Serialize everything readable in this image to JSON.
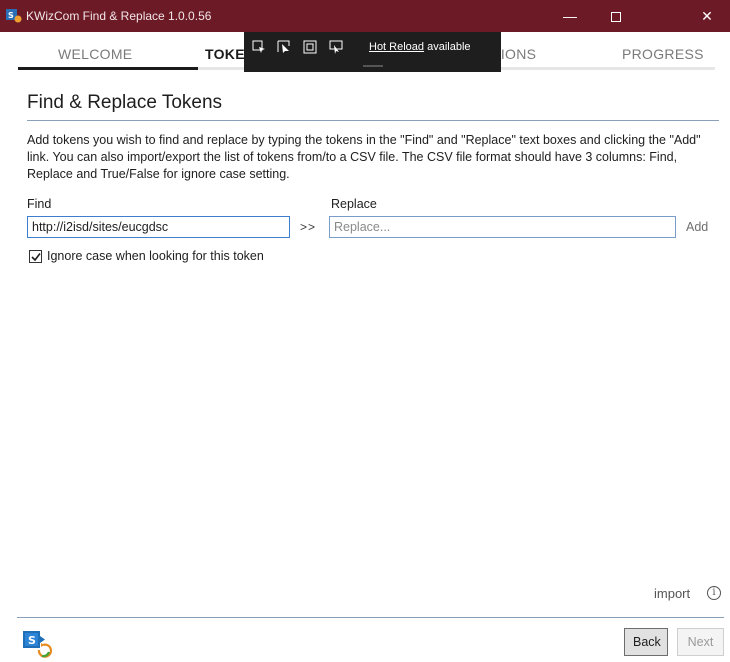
{
  "window": {
    "title": "KWizCom Find & Replace 1.0.0.56",
    "minimize_glyph": "—",
    "close_glyph": "✕"
  },
  "tabs": [
    {
      "label": "WELCOME"
    },
    {
      "label": "TOKEN"
    },
    {
      "label": "TIONS"
    },
    {
      "label": "PROGRESS"
    }
  ],
  "hot_reload": {
    "link_text": "Hot Reload",
    "suffix": " available",
    "icons": [
      "select-element-icon",
      "pointer-icon",
      "layout-adorner-icon",
      "track-focus-icon"
    ]
  },
  "page": {
    "title": "Find & Replace Tokens",
    "description": "Add tokens you wish to find and replace by typing the tokens in the \"Find\" and \"Replace\" text boxes and clicking the \"Add\" link. You can also import/export the list of tokens from/to a CSV file. The CSV file format should have 3 columns: Find, Replace and True/False for ignore case setting."
  },
  "form": {
    "find_label": "Find",
    "find_value": "http://i2isd/sites/eucgdsc",
    "arrows": ">>",
    "replace_label": "Replace",
    "replace_placeholder": "Replace...",
    "add_label": "Add",
    "ignore_case_label": "Ignore case when looking for this token",
    "ignore_case_checked": true
  },
  "bottom": {
    "import_label": "import",
    "info_glyph": "i"
  },
  "footer": {
    "back_label": "Back",
    "next_label": "Next"
  },
  "colors": {
    "titlebar": "#6b1a26",
    "accent_border": "#3c7fd1",
    "divider": "#8aa0b8"
  }
}
